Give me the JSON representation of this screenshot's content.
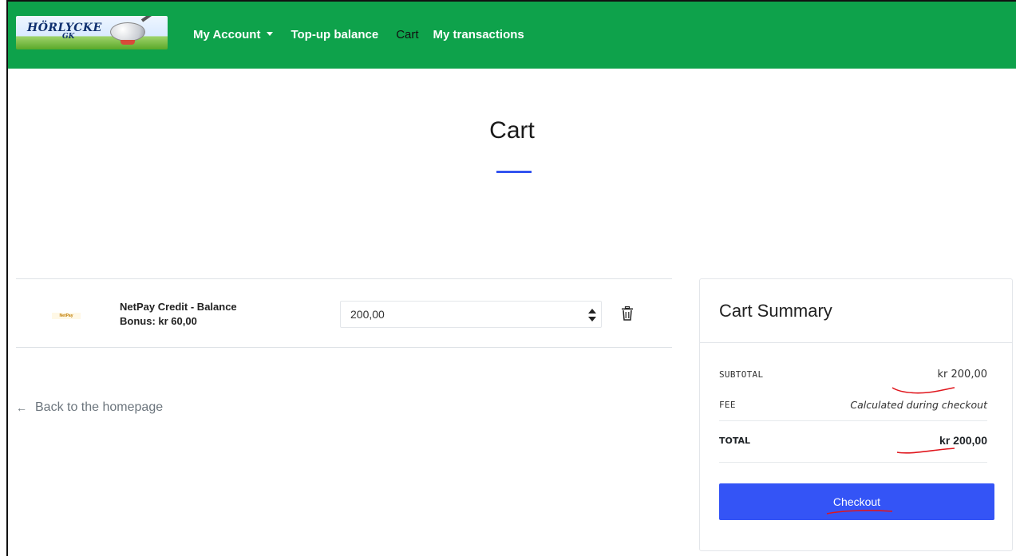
{
  "navbar": {
    "logo": {
      "text": "HÖRLYCKE",
      "sub": "GK"
    },
    "links": [
      {
        "label": "My Account",
        "dropdown": true
      },
      {
        "label": "Top-up balance"
      },
      {
        "label": "Cart",
        "active": true
      },
      {
        "label": "My transactions"
      }
    ],
    "background_color": "#0ea24b"
  },
  "page": {
    "title": "Cart",
    "accent_color": "#3454f0"
  },
  "cart": {
    "items": [
      {
        "thumbnail_text": "NetPay",
        "name": "NetPay Credit - Balance",
        "bonus": "Bonus: kr 60,00",
        "quantity_value": "200,00"
      }
    ],
    "back_link": "Back to the homepage"
  },
  "summary": {
    "title": "Cart Summary",
    "subtotal_label": "SUBTOTAL",
    "subtotal_value": "kr 200,00",
    "fee_label": "FEE",
    "fee_value": "Calculated during checkout",
    "total_label": "TOTAL",
    "total_value": "kr 200,00",
    "checkout_label": "Checkout",
    "button_color": "#3454f6",
    "annotation_color": "#e0161d"
  }
}
